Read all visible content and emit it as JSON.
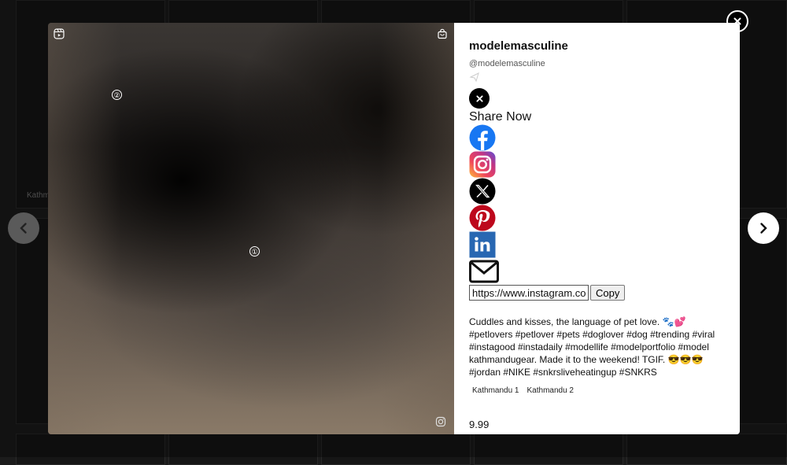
{
  "background": {
    "tile_label_left": "Kathm"
  },
  "modal": {
    "markers": [
      "①",
      "②"
    ],
    "media_icons": [
      "reel-icon",
      "shopping-bag-icon",
      "instagram-icon"
    ]
  },
  "panel": {
    "title": "modelemasculine",
    "handle": "@modelemasculine",
    "share_title": "Share Now",
    "share_icons": [
      "facebook-icon",
      "instagram-icon",
      "x-icon",
      "pinterest-icon",
      "linkedin-icon",
      "email-icon"
    ],
    "url_value": "https://www.instagram.com",
    "copy_label": "Copy",
    "caption": "Cuddles and kisses, the language of pet love. 🐾💕 #petlovers #petlover #pets #doglover #dog #trending #viral #instagood #instadaily #modellife #modelportfolio #model kathmandugear. Made it to the weekend! TGIF. 😎😎😎 #jordan #NIKE #snkrsliveheatingup #SNKRS",
    "tags": [
      "Kathmandu 1",
      "Kathmandu 2"
    ],
    "price": "9.99"
  },
  "colors": {
    "facebook": "#1877f2",
    "pinterest": "#bd081c",
    "linkedin": "#2867b2",
    "x": "#000000"
  }
}
